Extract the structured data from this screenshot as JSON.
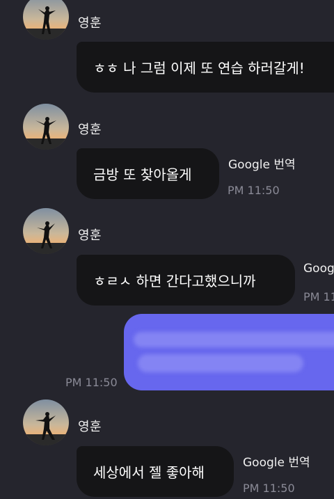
{
  "messages": [
    {
      "sender": "영훈",
      "text": "ㅎㅎ 나 그럼 이제 또 연습 하러갈게!",
      "translate_label": "",
      "time": ""
    },
    {
      "sender": "영훈",
      "text": "금방 또 찾아올게",
      "translate_label": "Google 번역",
      "time": "PM 11:50"
    },
    {
      "sender": "영훈",
      "text": "ㅎㄹㅅ 하면 간다고했으니까",
      "translate_label": "Goog",
      "time": "PM 11:"
    },
    {
      "sender": "영훈",
      "text": "세상에서 젤 좋아해",
      "translate_label": "Google 번역",
      "time": "PM 11:50"
    }
  ],
  "sent_message": {
    "time": "PM 11:50",
    "content": "redacted"
  },
  "colors": {
    "background": "#25252d",
    "received_bubble": "#151517",
    "sent_bubble": "#6767ee",
    "time_text": "#8a8a96"
  },
  "icons": {
    "avatar": "silhouette-at-sunset-avatar-icon"
  }
}
